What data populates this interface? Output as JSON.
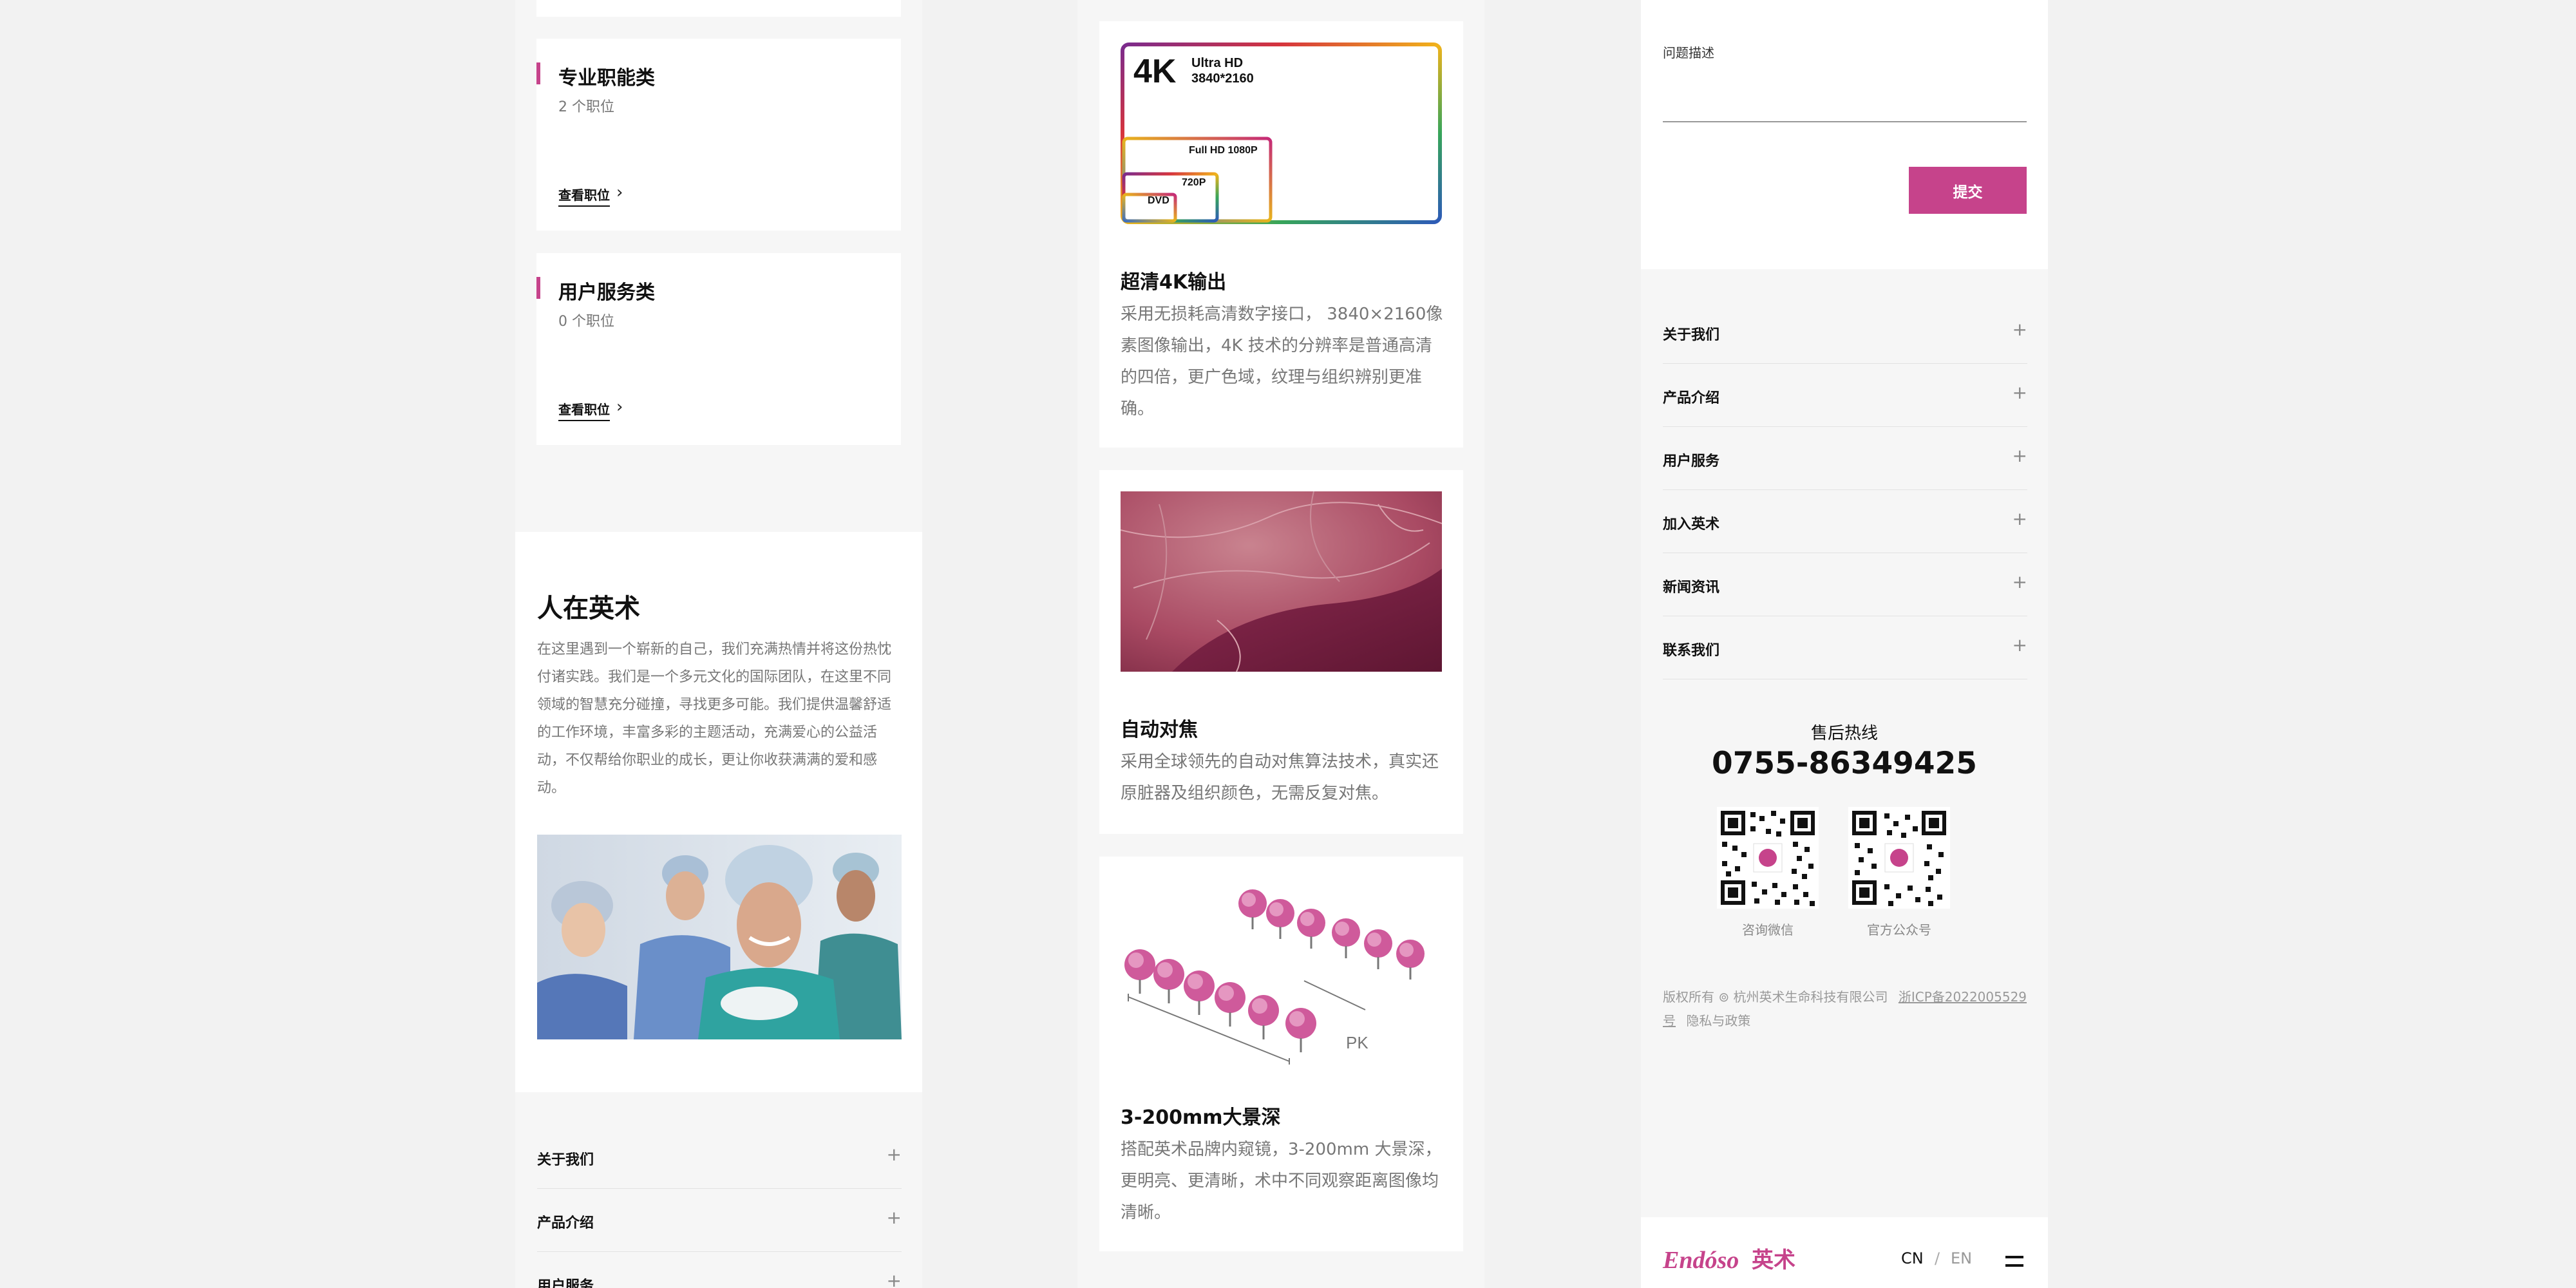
{
  "colors": {
    "accent": "#c6438b",
    "text": "#222222",
    "muted": "#777777",
    "background": "#f6f6f6"
  },
  "careers": {
    "categories": [
      {
        "title": "专业职能类",
        "count": "2 个职位",
        "link": "查看职位"
      },
      {
        "title": "用户服务类",
        "count": "0 个职位",
        "link": "查看职位"
      }
    ]
  },
  "about": {
    "title": "人在英术",
    "text": "在这里遇到一个崭新的自己，我们充满热情并将这份热忱付诸实践。我们是一个多元文化的国际团队，在这里不同领域的智慧充分碰撞，寻找更多可能。我们提供温馨舒适的工作环境，丰富多彩的主题活动，充满爱心的公益活动，不仅帮给你职业的成长，更让你收获满满的爱和感动。"
  },
  "left_nav": {
    "items": [
      "关于我们",
      "产品介绍",
      "用户服务"
    ]
  },
  "features": [
    {
      "title": "超清4K输出",
      "desc": "采用无损耗高清数字接口， 3840×2160像素图像输出，4K 技术的分辨率是普通高清的四倍，更广色域，纹理与组织辨别更准确。",
      "graphic": {
        "big": "4K",
        "uhd1": "Ultra HD",
        "uhd2": "3840*2160",
        "fhd": "Full HD 1080P",
        "hd": "720P",
        "dvd": "DVD"
      }
    },
    {
      "title": "自动对焦",
      "desc": "采用全球领先的自动对焦算法技术，真实还原脏器及组织颜色，无需反复对焦。"
    },
    {
      "title": "3-200mm大景深",
      "desc": "搭配英术品牌内窥镜，3-200mm 大景深，更明亮、更清晰，术中不同观察距离图像均清晰。",
      "graphic": {
        "pk": "PK"
      }
    }
  ],
  "form": {
    "label": "问题描述",
    "submit": "提交"
  },
  "footer_nav": {
    "items": [
      "关于我们",
      "产品介绍",
      "用户服务",
      "加入英术",
      "新闻资讯",
      "联系我们"
    ]
  },
  "hotline": {
    "title": "售后热线",
    "number": "0755-86349425"
  },
  "qrcodes": [
    {
      "caption": "咨询微信"
    },
    {
      "caption": "官方公众号"
    }
  ],
  "copyright": {
    "text": "版权所有 ⊚ 杭州英术生命科技有限公司",
    "icp": "浙ICP备2022005529号",
    "privacy": "隐私与政策"
  },
  "header": {
    "logo_en": "Endóso",
    "logo_cn": "英术",
    "lang_cn": "CN",
    "lang_sep": "/",
    "lang_en": "EN"
  }
}
